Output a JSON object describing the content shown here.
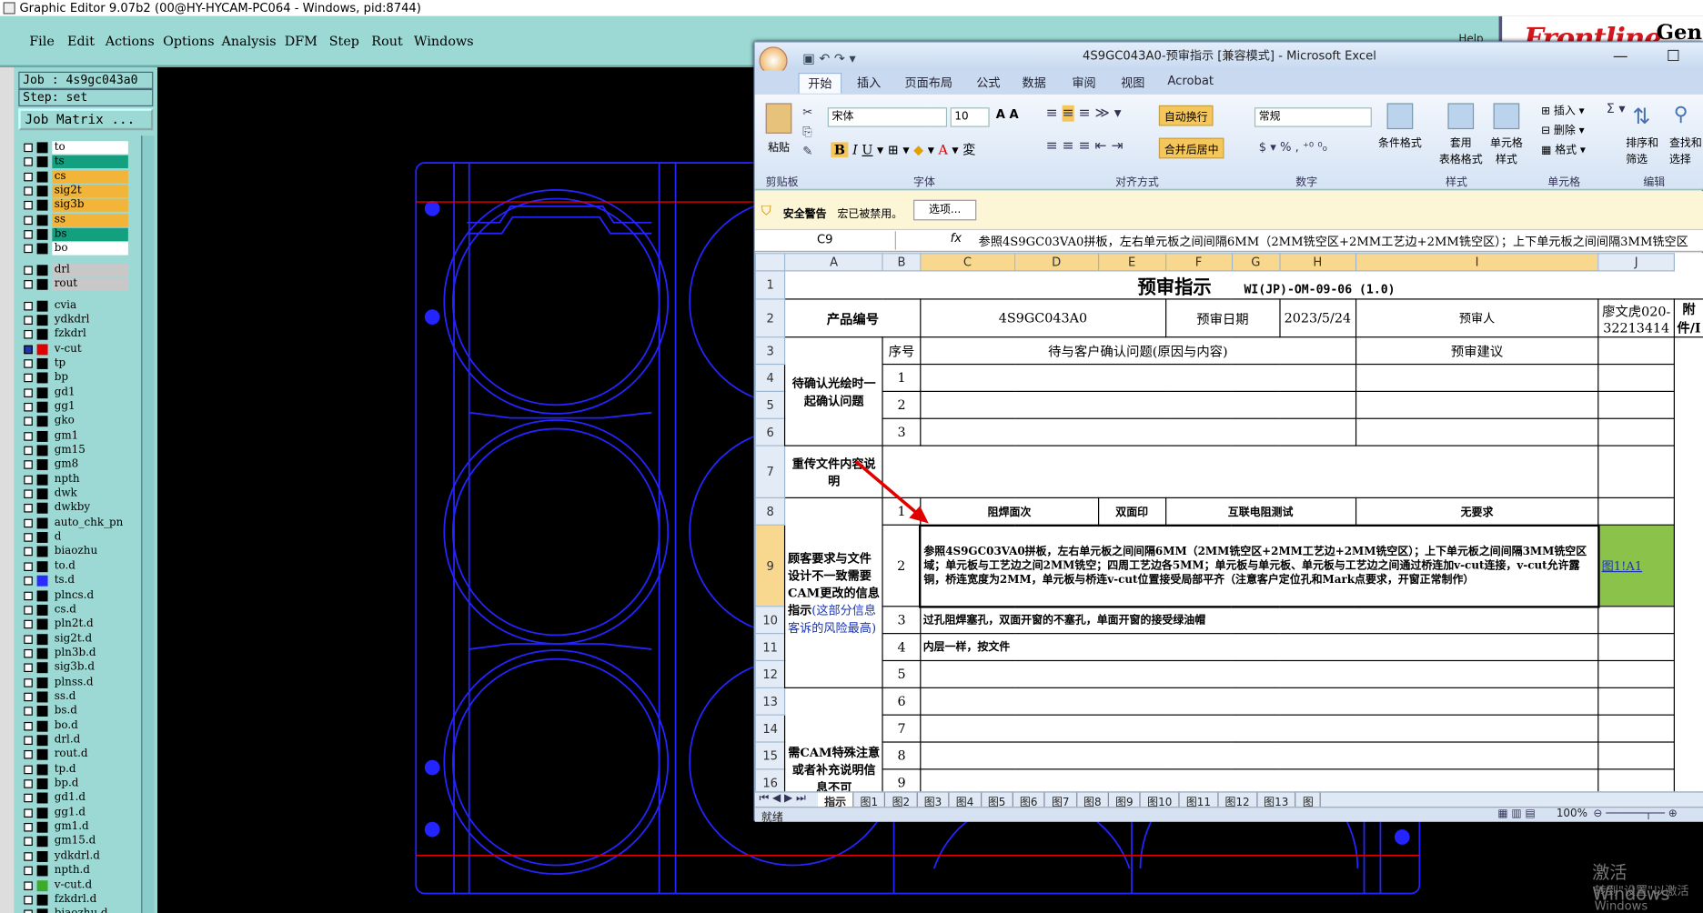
{
  "graphic_editor": {
    "title": "Graphic Editor 9.07b2 (00@HY-HYCAM-PC064 - Windows, pid:8744)",
    "menu": [
      "File",
      "Edit",
      "Actions",
      "Options",
      "Analysis",
      "DFM",
      "Step",
      "Rout",
      "Windows"
    ],
    "logo_text": "Frontline",
    "logo_text2": "Gene",
    "help_text": "Help",
    "job": "Job : 4s9gc043a0",
    "step": "Step: set",
    "job_matrix": "Job Matrix ...",
    "layers": [
      {
        "name": "to",
        "color": "#ffffff"
      },
      {
        "name": "ts",
        "color": "#12a07e"
      },
      {
        "name": "cs",
        "color": "#f2b539"
      },
      {
        "name": "sig2t",
        "color": "#f2b539"
      },
      {
        "name": "sig3b",
        "color": "#f2b539"
      },
      {
        "name": "ss",
        "color": "#f2b539"
      },
      {
        "name": "bs",
        "color": "#12a07e"
      },
      {
        "name": "bo",
        "color": "#ffffff"
      },
      {
        "name": "drl",
        "color": "#c8c8c8"
      },
      {
        "name": "rout",
        "color": "#c8c8c8"
      },
      {
        "name": "cvia",
        "color": "#9cd9d4"
      },
      {
        "name": "ydkdrl",
        "color": "#9cd9d4"
      },
      {
        "name": "fzkdrl",
        "color": "#9cd9d4"
      },
      {
        "name": "v-cut",
        "color": "#9cd9d4"
      },
      {
        "name": "tp",
        "color": "#9cd9d4"
      },
      {
        "name": "bp",
        "color": "#9cd9d4"
      },
      {
        "name": "gd1",
        "color": "#9cd9d4"
      },
      {
        "name": "gg1",
        "color": "#9cd9d4"
      },
      {
        "name": "gko",
        "color": "#9cd9d4"
      },
      {
        "name": "gm1",
        "color": "#9cd9d4"
      },
      {
        "name": "gm15",
        "color": "#9cd9d4"
      },
      {
        "name": "gm8",
        "color": "#9cd9d4"
      },
      {
        "name": "npth",
        "color": "#9cd9d4"
      },
      {
        "name": "dwk",
        "color": "#9cd9d4"
      },
      {
        "name": "dwkby",
        "color": "#9cd9d4"
      },
      {
        "name": "auto_chk_pn",
        "color": "#9cd9d4"
      },
      {
        "name": "d",
        "color": "#9cd9d4"
      },
      {
        "name": "biaozhu",
        "color": "#9cd9d4"
      },
      {
        "name": "to.d",
        "color": "#9cd9d4"
      },
      {
        "name": "ts.d",
        "color": "#9cd9d4"
      },
      {
        "name": "plncs.d",
        "color": "#9cd9d4"
      },
      {
        "name": "cs.d",
        "color": "#9cd9d4"
      },
      {
        "name": "pln2t.d",
        "color": "#9cd9d4"
      },
      {
        "name": "sig2t.d",
        "color": "#9cd9d4"
      },
      {
        "name": "pln3b.d",
        "color": "#9cd9d4"
      },
      {
        "name": "sig3b.d",
        "color": "#9cd9d4"
      },
      {
        "name": "plnss.d",
        "color": "#9cd9d4"
      },
      {
        "name": "ss.d",
        "color": "#9cd9d4"
      },
      {
        "name": "bs.d",
        "color": "#9cd9d4"
      },
      {
        "name": "bo.d",
        "color": "#9cd9d4"
      },
      {
        "name": "drl.d",
        "color": "#9cd9d4"
      },
      {
        "name": "rout.d",
        "color": "#9cd9d4"
      },
      {
        "name": "tp.d",
        "color": "#9cd9d4"
      },
      {
        "name": "bp.d",
        "color": "#9cd9d4"
      },
      {
        "name": "gd1.d",
        "color": "#9cd9d4"
      },
      {
        "name": "gg1.d",
        "color": "#9cd9d4"
      },
      {
        "name": "gm1.d",
        "color": "#9cd9d4"
      },
      {
        "name": "gm15.d",
        "color": "#9cd9d4"
      },
      {
        "name": "ydkdrl.d",
        "color": "#9cd9d4"
      },
      {
        "name": "npth.d",
        "color": "#9cd9d4"
      },
      {
        "name": "v-cut.d",
        "color": "#9cd9d4"
      },
      {
        "name": "fzkdrl.d",
        "color": "#9cd9d4"
      },
      {
        "name": "biaozhu.d",
        "color": "#9cd9d4"
      }
    ]
  },
  "excel": {
    "title": "4S9GC043A0-预审指示  [兼容模式] - Microsoft Excel",
    "ribbon_tabs": [
      "开始",
      "插入",
      "页面布局",
      "公式",
      "数据",
      "审阅",
      "视图",
      "Acrobat"
    ],
    "font_name": "宋体",
    "font_size": "10",
    "wrap_text": "自动换行",
    "merge_center": "合并后居中",
    "number_format": "常规",
    "cond_format": "条件格式",
    "table_format": "套用\n表格格式",
    "cell_style": "单元格\n样式",
    "insert": "插入",
    "delete": "删除",
    "format": "格式",
    "sort_filter": "排序和\n筛选",
    "find_select": "查找和\n选择",
    "paste": "粘贴",
    "groups": [
      "剪贴板",
      "字体",
      "对齐方式",
      "数字",
      "样式",
      "单元格",
      "编辑"
    ],
    "security_warning": "安全警告",
    "macro_disabled": "宏已被禁用。",
    "options_button": "选项...",
    "name_box": "C9",
    "fx": "fx",
    "formula": "参照4S9GC03VA0拼板，左右单元板之间间隔6MM（2MM铣空区+2MM工艺边+2MM铣空区）；上下单元板之间间隔3MM铣空区",
    "columns": [
      "A",
      "B",
      "C",
      "D",
      "E",
      "F",
      "G",
      "H",
      "I",
      "J"
    ],
    "rows": [
      "1",
      "2",
      "3",
      "4",
      "5",
      "6",
      "7",
      "8",
      "9",
      "10",
      "11",
      "12",
      "13",
      "14",
      "15",
      "16"
    ],
    "sheet_title": "预审指示",
    "doc_code": "WI(JP)-OM-09-06 (1.0)",
    "product_label": "产品编号",
    "product_value": "4S9GC043A0",
    "review_date_label": "预审日期",
    "review_date_value": "2023/5/24",
    "reviewer_label": "预审人",
    "reviewer_value": "廖文虎020-32213414",
    "attachment_label": "附件/I",
    "seq_label": "序号",
    "question_label": "待与客户确认问题(原因与内容)",
    "suggestion_label": "预审建议",
    "pending_label": "待确认光绘时一起确认问题",
    "reupload_label": "重传文件内容说明",
    "mismatch_label_black": "顾客要求与文件设计不一致需要CAM更改的信息指示",
    "mismatch_label_blue": "(这部分信息客诉的风险最高)",
    "special_label": "需CAM特殊注意或者补充说明信息不可",
    "row8": {
      "num": "1",
      "solder": "阻焊面次",
      "print": "双面印",
      "test": "互联电阻测试",
      "none": "无要求"
    },
    "row9": {
      "num": "2",
      "text": "参照4S9GC03VA0拼板，左右单元板之间间隔6MM（2MM铣空区+2MM工艺边+2MM铣空区）；上下单元板之间间隔3MM铣空区域；单元板与工艺边之间2MM铣空；四周工艺边各5MM；单元板与单元板、单元板与工艺边之间通过桥连加v-cut连接，v-cut允许露铜，桥连宽度为2MM，单元板与桥连v-cut位置接受局部平齐（注意客户定位孔和Mark点要求，开窗正常制作）",
      "link": "图1!A1"
    },
    "row10": {
      "num": "3",
      "text": "过孔阻焊塞孔，双面开窗的不塞孔，单面开窗的接受绿油帽"
    },
    "row11": {
      "num": "4",
      "text": "内层一样，按文件"
    },
    "nums_pending": [
      "1",
      "2",
      "3"
    ],
    "nums_more": [
      "5",
      "6",
      "7",
      "8",
      "9"
    ],
    "sheet_tabs": [
      "指示",
      "图1",
      "图2",
      "图3",
      "图4",
      "图5",
      "图6",
      "图7",
      "图8",
      "图9",
      "图10",
      "图11",
      "图12",
      "图13",
      "图"
    ],
    "status_ready": "就绪",
    "zoom": "100%"
  },
  "watermark": {
    "line1": "激活 Windows",
    "line2": "转到\"设置\"以激活 Windows"
  },
  "colors": {
    "teal": "#9cd9d4",
    "blue_outline": "#2424ff",
    "red_line": "#e00000",
    "arrow": "#e00000",
    "excel_green": "#8bc34a"
  }
}
